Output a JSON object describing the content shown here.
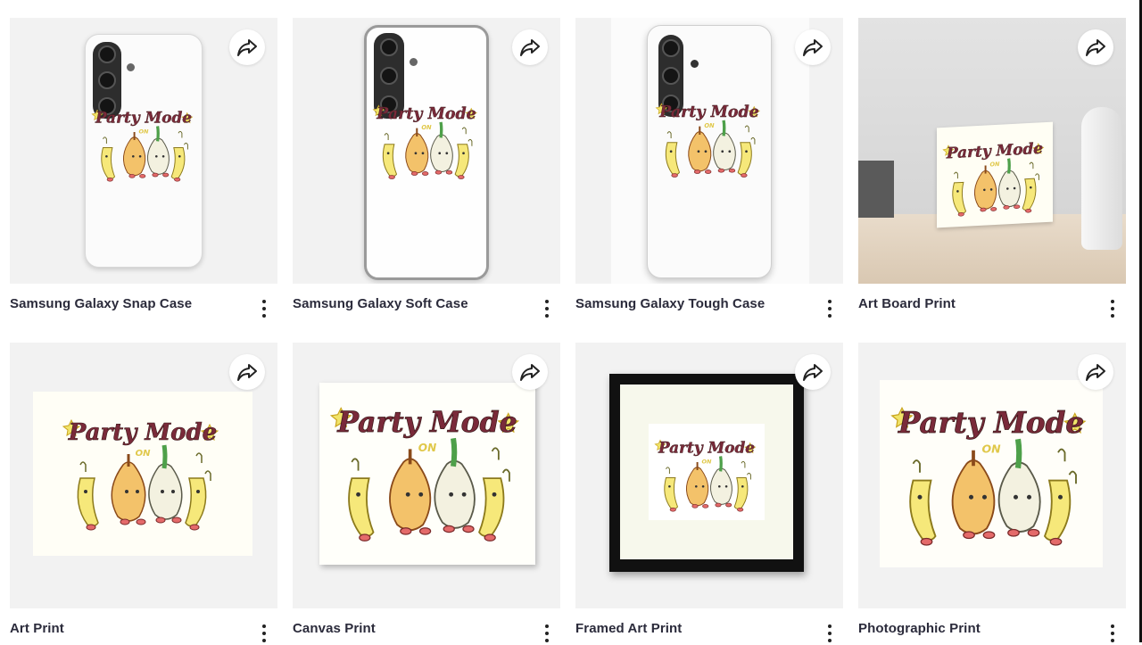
{
  "products": [
    {
      "title": "Samsung Galaxy Snap Case",
      "art": "Party Mode",
      "subtitle": "ON"
    },
    {
      "title": "Samsung Galaxy Soft Case",
      "art": "Party Mode",
      "subtitle": "ON"
    },
    {
      "title": "Samsung Galaxy Tough Case",
      "art": "Party Mode",
      "subtitle": "ON"
    },
    {
      "title": "Art Board Print",
      "art": "Party Mode",
      "subtitle": "ON"
    },
    {
      "title": "Art Print",
      "art": "Party Mode",
      "subtitle": "ON"
    },
    {
      "title": "Canvas Print",
      "art": "Party Mode",
      "subtitle": "ON"
    },
    {
      "title": "Framed Art Print",
      "art": "Party Mode",
      "subtitle": "ON"
    },
    {
      "title": "Photographic Print",
      "art": "Party Mode",
      "subtitle": "ON"
    }
  ],
  "icons": {
    "share": "share-arrow-icon",
    "more": "more-vertical-icon"
  },
  "colors": {
    "title": "#2b2b3b",
    "thumb_bg": "#f2f2f2",
    "art_title": "#7a2a3a",
    "art_yellow": "#f1e46a"
  }
}
